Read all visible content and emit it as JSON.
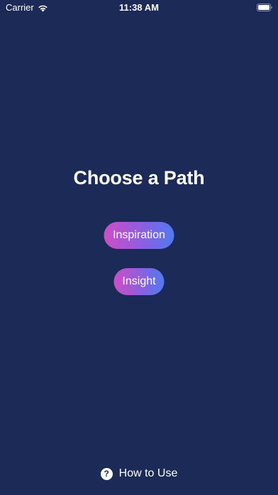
{
  "status_bar": {
    "carrier": "Carrier",
    "time": "11:38 AM",
    "wifi_icon": "wifi-icon",
    "battery_icon": "battery-icon"
  },
  "main": {
    "title": "Choose a Path",
    "buttons": [
      {
        "label": "Inspiration"
      },
      {
        "label": "Insight"
      }
    ]
  },
  "footer": {
    "help_icon": "question-circle-icon",
    "help_glyph": "?",
    "how_to_label": "How to Use"
  },
  "colors": {
    "background": "#1b2a56",
    "gradient_start": "#cf4dc6",
    "gradient_end": "#4f7bf0",
    "text": "#ffffff"
  }
}
